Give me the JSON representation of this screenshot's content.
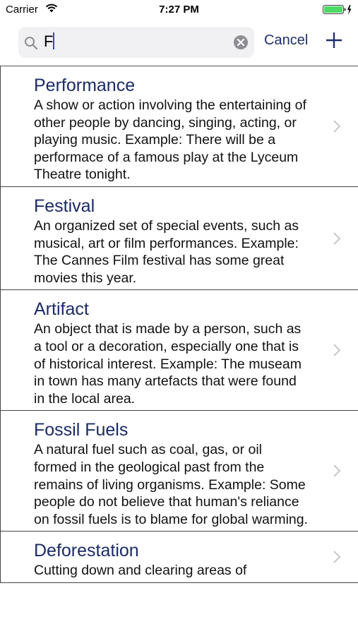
{
  "status": {
    "carrier": "Carrier",
    "time": "7:27 PM"
  },
  "search": {
    "query": "F",
    "cancel_label": "Cancel"
  },
  "words": [
    {
      "title": "Performance",
      "definition": " A show or action involving the entertaining of other people by dancing, singing, acting, or playing music. Example: There will be a performace of a famous play at the Lyceum Theatre tonight."
    },
    {
      "title": "Festival",
      "definition": " An organized set of special events, such as musical, art or film performances. Example: The Cannes Film festival has some great movies this year."
    },
    {
      "title": "Artifact",
      "definition": " An object that is made by a person, such as a tool or a decoration, especially one that is of historical interest. Example: The museam in town has many artefacts that were found in the local area."
    },
    {
      "title": "Fossil Fuels",
      "definition": " A natural fuel such as coal, gas, or oil formed in the geological past from the remains of living organisms. Example: Some people do not believe that human's reliance on fossil fuels is to blame for global warming."
    },
    {
      "title": "Deforestation",
      "definition": " Cutting down and clearing areas of"
    }
  ],
  "colors": {
    "accent": "#1b2a66",
    "battery": "#4cd964"
  }
}
